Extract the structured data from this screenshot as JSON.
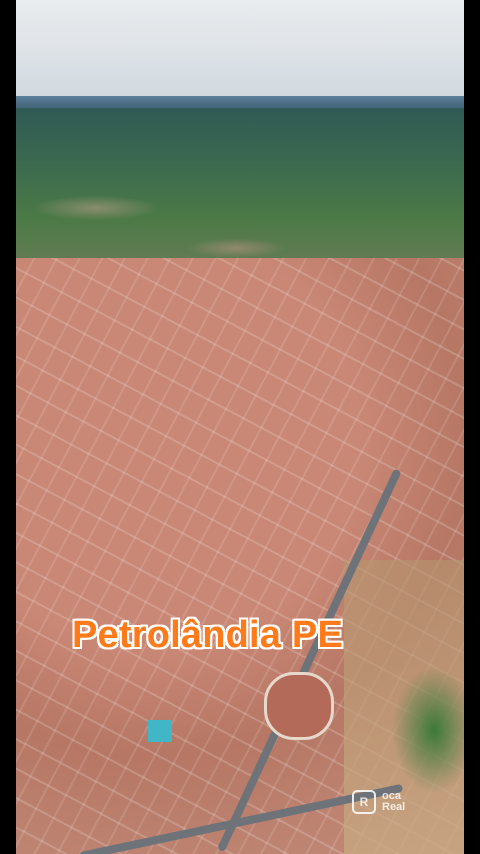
{
  "overlay": {
    "title": "Petrolândia PE"
  },
  "watermark": {
    "icon": "realestate-logo-icon",
    "line1": "oca",
    "line2": "Real"
  },
  "colors": {
    "title_fill": "#ff7a1a",
    "title_outline": "#ffffff"
  }
}
